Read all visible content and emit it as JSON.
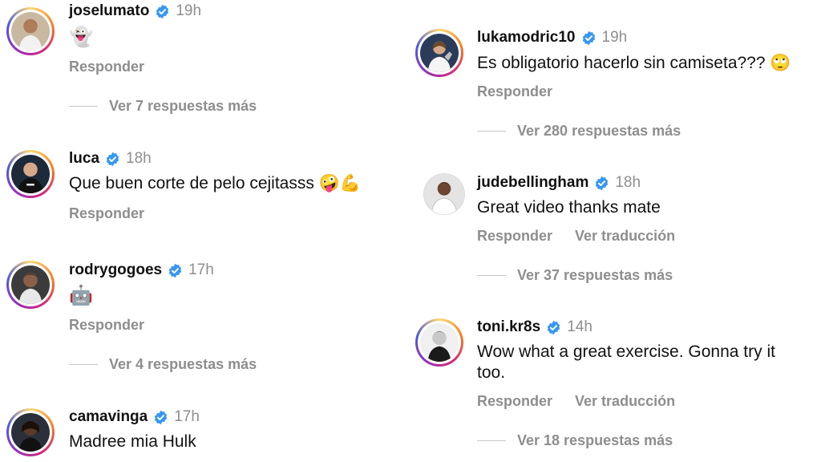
{
  "comments": [
    {
      "username": "joselumato",
      "time": "19h",
      "text": "👻",
      "reply": "Responder",
      "more": "Ver 7 respuestas más"
    },
    {
      "username": "luca",
      "time": "18h",
      "text": "Que buen corte de pelo cejitasss 🤪💪",
      "reply": "Responder"
    },
    {
      "username": "rodrygogoes",
      "time": "17h",
      "text": "🤖",
      "reply": "Responder",
      "more": "Ver 4 respuestas más"
    },
    {
      "username": "camavinga",
      "time": "17h",
      "text": "Madree mia Hulk"
    },
    {
      "username": "lukamodric10",
      "time": "19h",
      "text": "Es obligatorio hacerlo sin camiseta??? 🙄",
      "reply": "Responder",
      "more": "Ver 280 respuestas más"
    },
    {
      "username": "judebellingham",
      "time": "18h",
      "text": "Great video thanks mate",
      "reply": "Responder",
      "translate": "Ver traducción",
      "more": "Ver 37 respuestas más"
    },
    {
      "username": "toni.kr8s",
      "time": "14h",
      "text_line1": "Wow what a great exercise. Gonna try it",
      "text_line2": "too.",
      "reply": "Responder",
      "translate": "Ver traducción",
      "more": "Ver 18 respuestas más"
    }
  ],
  "colors": {
    "verified": "#3897f0",
    "muted": "#8e8e8e",
    "story_ring": "#d62976"
  }
}
